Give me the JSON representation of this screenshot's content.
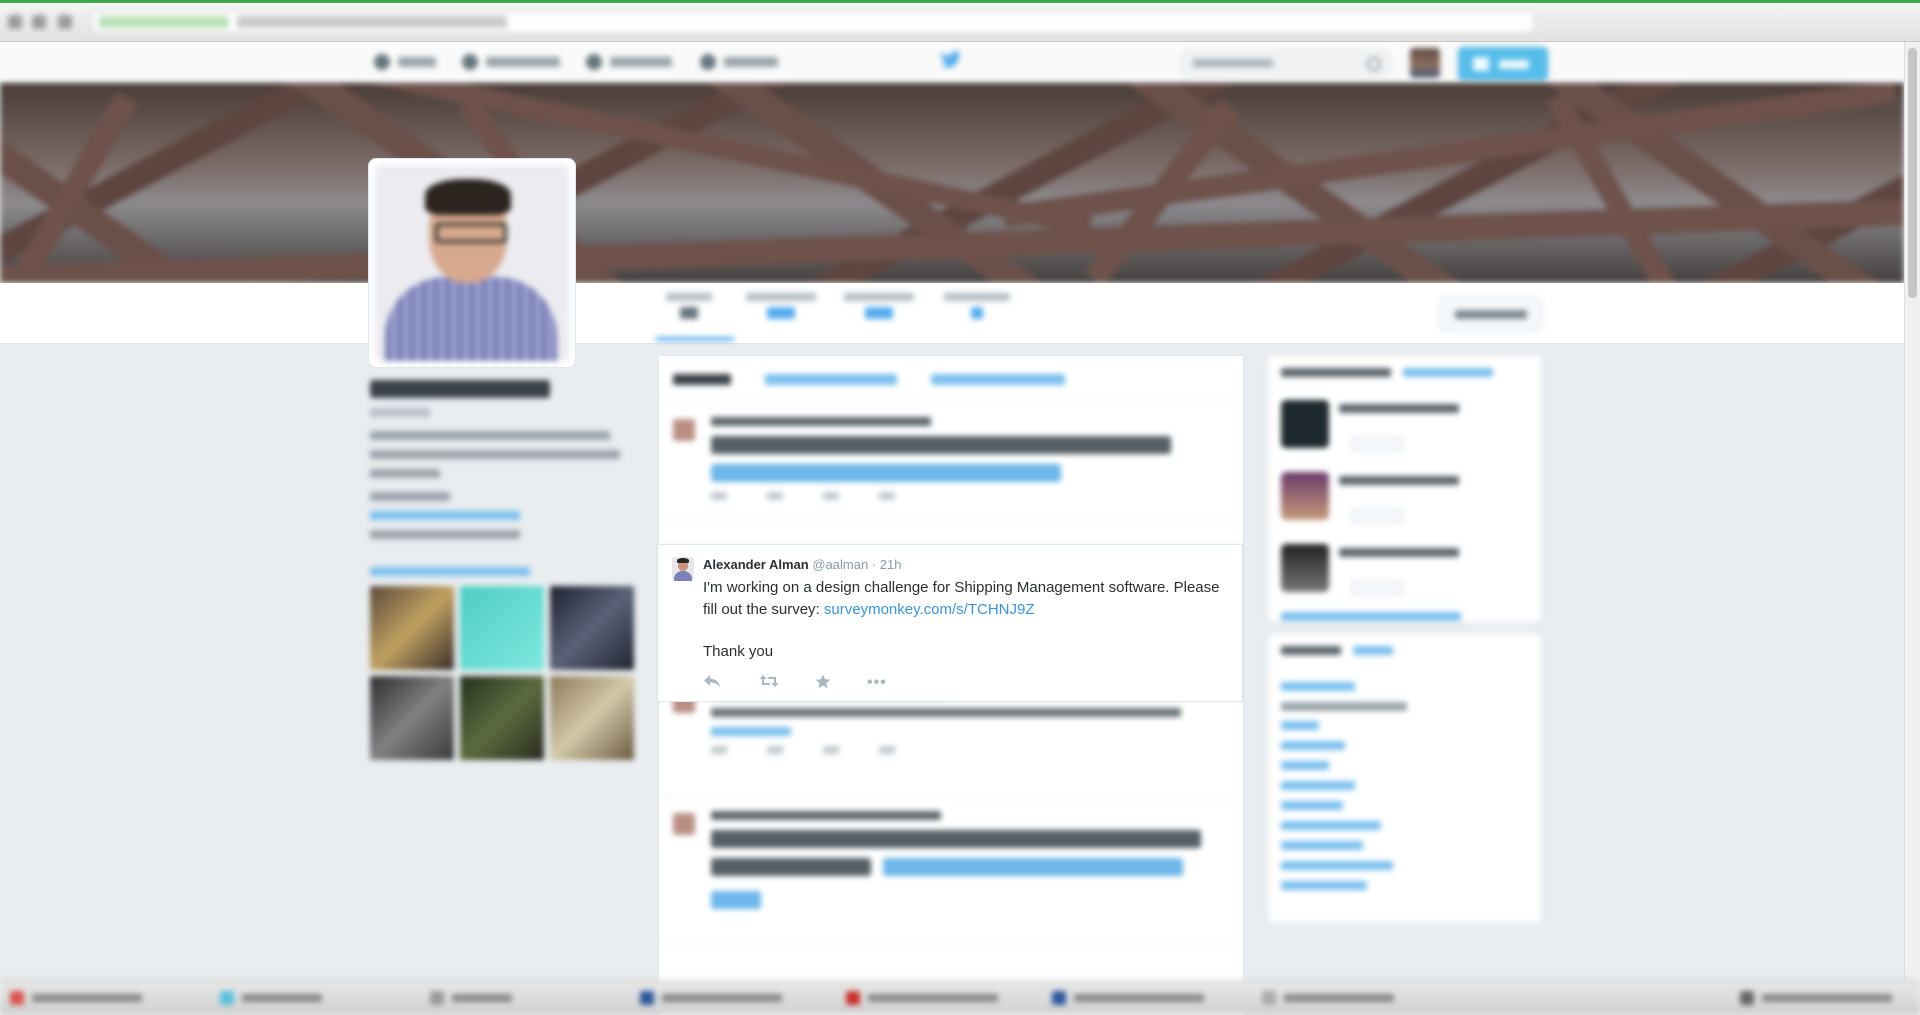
{
  "focused_tweet": {
    "author": "Alexander Alman",
    "handle": "@aalman",
    "separator": "·",
    "time": "21h",
    "text_before_link": "I'm working on a design challenge for Shipping Management software. Please fill out the survey: ",
    "link_text": "surveymonkey.com/s/TCHNJ9Z",
    "closing": "Thank you",
    "actions": {
      "reply_icon": "reply-icon",
      "retweet_icon": "retweet-icon",
      "favorite_icon": "star-icon",
      "more_icon": "ellipsis-icon",
      "more_glyph": "•••"
    }
  },
  "colors": {
    "link": "#3b94d9",
    "accent": "#55acee",
    "tweet_button": "#55bdea",
    "muted": "#8899a6",
    "browser_accent": "#3fa54f"
  },
  "icons": {
    "brand": "twitter-bird-icon",
    "search": "search-icon"
  }
}
